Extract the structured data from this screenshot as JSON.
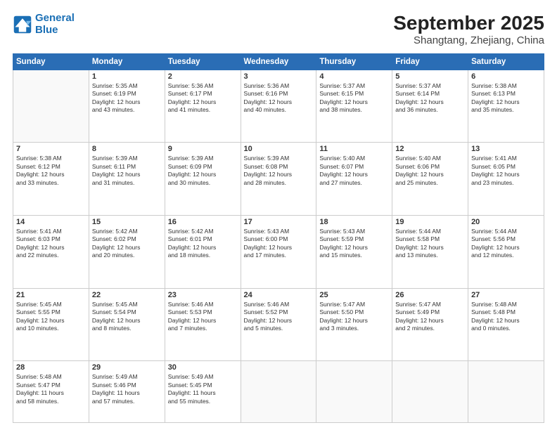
{
  "header": {
    "logo_line1": "General",
    "logo_line2": "Blue",
    "month": "September 2025",
    "location": "Shangtang, Zhejiang, China"
  },
  "weekdays": [
    "Sunday",
    "Monday",
    "Tuesday",
    "Wednesday",
    "Thursday",
    "Friday",
    "Saturday"
  ],
  "weeks": [
    [
      {
        "day": "",
        "text": ""
      },
      {
        "day": "1",
        "text": "Sunrise: 5:35 AM\nSunset: 6:19 PM\nDaylight: 12 hours\nand 43 minutes."
      },
      {
        "day": "2",
        "text": "Sunrise: 5:36 AM\nSunset: 6:17 PM\nDaylight: 12 hours\nand 41 minutes."
      },
      {
        "day": "3",
        "text": "Sunrise: 5:36 AM\nSunset: 6:16 PM\nDaylight: 12 hours\nand 40 minutes."
      },
      {
        "day": "4",
        "text": "Sunrise: 5:37 AM\nSunset: 6:15 PM\nDaylight: 12 hours\nand 38 minutes."
      },
      {
        "day": "5",
        "text": "Sunrise: 5:37 AM\nSunset: 6:14 PM\nDaylight: 12 hours\nand 36 minutes."
      },
      {
        "day": "6",
        "text": "Sunrise: 5:38 AM\nSunset: 6:13 PM\nDaylight: 12 hours\nand 35 minutes."
      }
    ],
    [
      {
        "day": "7",
        "text": "Sunrise: 5:38 AM\nSunset: 6:12 PM\nDaylight: 12 hours\nand 33 minutes."
      },
      {
        "day": "8",
        "text": "Sunrise: 5:39 AM\nSunset: 6:11 PM\nDaylight: 12 hours\nand 31 minutes."
      },
      {
        "day": "9",
        "text": "Sunrise: 5:39 AM\nSunset: 6:09 PM\nDaylight: 12 hours\nand 30 minutes."
      },
      {
        "day": "10",
        "text": "Sunrise: 5:39 AM\nSunset: 6:08 PM\nDaylight: 12 hours\nand 28 minutes."
      },
      {
        "day": "11",
        "text": "Sunrise: 5:40 AM\nSunset: 6:07 PM\nDaylight: 12 hours\nand 27 minutes."
      },
      {
        "day": "12",
        "text": "Sunrise: 5:40 AM\nSunset: 6:06 PM\nDaylight: 12 hours\nand 25 minutes."
      },
      {
        "day": "13",
        "text": "Sunrise: 5:41 AM\nSunset: 6:05 PM\nDaylight: 12 hours\nand 23 minutes."
      }
    ],
    [
      {
        "day": "14",
        "text": "Sunrise: 5:41 AM\nSunset: 6:03 PM\nDaylight: 12 hours\nand 22 minutes."
      },
      {
        "day": "15",
        "text": "Sunrise: 5:42 AM\nSunset: 6:02 PM\nDaylight: 12 hours\nand 20 minutes."
      },
      {
        "day": "16",
        "text": "Sunrise: 5:42 AM\nSunset: 6:01 PM\nDaylight: 12 hours\nand 18 minutes."
      },
      {
        "day": "17",
        "text": "Sunrise: 5:43 AM\nSunset: 6:00 PM\nDaylight: 12 hours\nand 17 minutes."
      },
      {
        "day": "18",
        "text": "Sunrise: 5:43 AM\nSunset: 5:59 PM\nDaylight: 12 hours\nand 15 minutes."
      },
      {
        "day": "19",
        "text": "Sunrise: 5:44 AM\nSunset: 5:58 PM\nDaylight: 12 hours\nand 13 minutes."
      },
      {
        "day": "20",
        "text": "Sunrise: 5:44 AM\nSunset: 5:56 PM\nDaylight: 12 hours\nand 12 minutes."
      }
    ],
    [
      {
        "day": "21",
        "text": "Sunrise: 5:45 AM\nSunset: 5:55 PM\nDaylight: 12 hours\nand 10 minutes."
      },
      {
        "day": "22",
        "text": "Sunrise: 5:45 AM\nSunset: 5:54 PM\nDaylight: 12 hours\nand 8 minutes."
      },
      {
        "day": "23",
        "text": "Sunrise: 5:46 AM\nSunset: 5:53 PM\nDaylight: 12 hours\nand 7 minutes."
      },
      {
        "day": "24",
        "text": "Sunrise: 5:46 AM\nSunset: 5:52 PM\nDaylight: 12 hours\nand 5 minutes."
      },
      {
        "day": "25",
        "text": "Sunrise: 5:47 AM\nSunset: 5:50 PM\nDaylight: 12 hours\nand 3 minutes."
      },
      {
        "day": "26",
        "text": "Sunrise: 5:47 AM\nSunset: 5:49 PM\nDaylight: 12 hours\nand 2 minutes."
      },
      {
        "day": "27",
        "text": "Sunrise: 5:48 AM\nSunset: 5:48 PM\nDaylight: 12 hours\nand 0 minutes."
      }
    ],
    [
      {
        "day": "28",
        "text": "Sunrise: 5:48 AM\nSunset: 5:47 PM\nDaylight: 11 hours\nand 58 minutes."
      },
      {
        "day": "29",
        "text": "Sunrise: 5:49 AM\nSunset: 5:46 PM\nDaylight: 11 hours\nand 57 minutes."
      },
      {
        "day": "30",
        "text": "Sunrise: 5:49 AM\nSunset: 5:45 PM\nDaylight: 11 hours\nand 55 minutes."
      },
      {
        "day": "",
        "text": ""
      },
      {
        "day": "",
        "text": ""
      },
      {
        "day": "",
        "text": ""
      },
      {
        "day": "",
        "text": ""
      }
    ]
  ]
}
